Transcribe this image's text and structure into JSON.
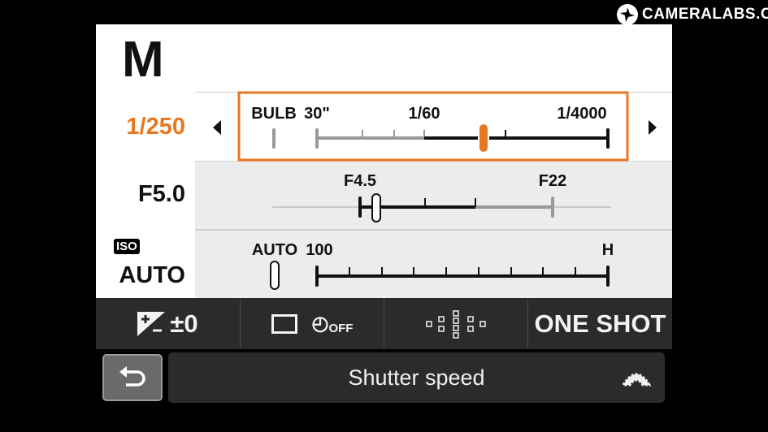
{
  "logo": {
    "text": "CAMERALABS.COM"
  },
  "mode": "M",
  "shutter": {
    "value": "1/250",
    "scale_labels": [
      "BULB",
      "30\"",
      "1/60",
      "1/4000"
    ],
    "arrow_left": "left-arrow-icon",
    "arrow_right": "right-arrow-icon"
  },
  "aperture": {
    "value": "F5.0",
    "scale_labels": [
      "F4.5",
      "F22"
    ]
  },
  "iso": {
    "badge": "ISO",
    "value": "AUTO",
    "scale_labels": [
      "AUTO",
      "100",
      "H"
    ]
  },
  "quick_bar": {
    "exposure_comp": "±0",
    "drive_self_timer": "OFF",
    "af_mode": "ONE SHOT"
  },
  "footer": {
    "title": "Shutter speed",
    "back_icon": "back-arrow-icon",
    "dial_icon": "main-dial-icon"
  },
  "colors": {
    "accent": "#e87722",
    "panel": "#ffffff",
    "row_alt": "#ececec",
    "bar": "#2b2b2b"
  }
}
